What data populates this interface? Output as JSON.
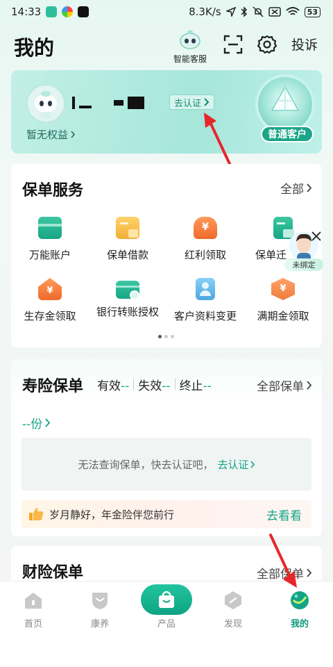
{
  "status_bar": {
    "time": "14:33",
    "net_speed": "8.3K/s",
    "battery": "53"
  },
  "header": {
    "title": "我的",
    "customer_service": "智能客服",
    "complain": "投诉"
  },
  "profile": {
    "verify_label": "去认证",
    "benefit_text": "暂无权益",
    "member_level": "普通客户"
  },
  "policy_service": {
    "title": "保单服务",
    "more": "全部",
    "items": [
      {
        "label": "万能账户",
        "icon": "wallet-icon",
        "color": "#24b28f"
      },
      {
        "label": "保单借款",
        "icon": "folder-icon",
        "color": "#f3b84a"
      },
      {
        "label": "红利领取",
        "icon": "bonus-icon",
        "color": "#f07a3a"
      },
      {
        "label": "保单迁",
        "icon": "policy-transfer-icon",
        "color": "#23b092"
      },
      {
        "label": "生存金领取",
        "icon": "house-coin-icon",
        "color": "#f07d3b"
      },
      {
        "label": "银行转账授权",
        "icon": "card-check-icon",
        "color": "#2bb395"
      },
      {
        "label": "客户资料变更",
        "icon": "profile-icon",
        "color": "#4aa7e0"
      },
      {
        "label": "满期金领取",
        "icon": "hexagon-coin-icon",
        "color": "#f08c48"
      }
    ],
    "floating_tag": "未绑定"
  },
  "life_policy": {
    "title": "寿险保单",
    "stats": [
      {
        "label": "有效",
        "value": "--"
      },
      {
        "label": "失效",
        "value": "--"
      },
      {
        "label": "终止",
        "value": "--"
      }
    ],
    "more": "全部保单",
    "count": "--份",
    "empty_text": "无法查询保单，快去认证吧，",
    "empty_link": "去认证",
    "promo_text": "岁月静好，年金险伴您前行",
    "promo_action": "去看看"
  },
  "property_policy": {
    "title": "财险保单",
    "more": "全部保单"
  },
  "nav": {
    "home": "首页",
    "health": "康养",
    "product": "产品",
    "discover": "发现",
    "mine": "我的"
  },
  "colors": {
    "accent": "#13a487",
    "annotation_red": "#e8262a"
  }
}
